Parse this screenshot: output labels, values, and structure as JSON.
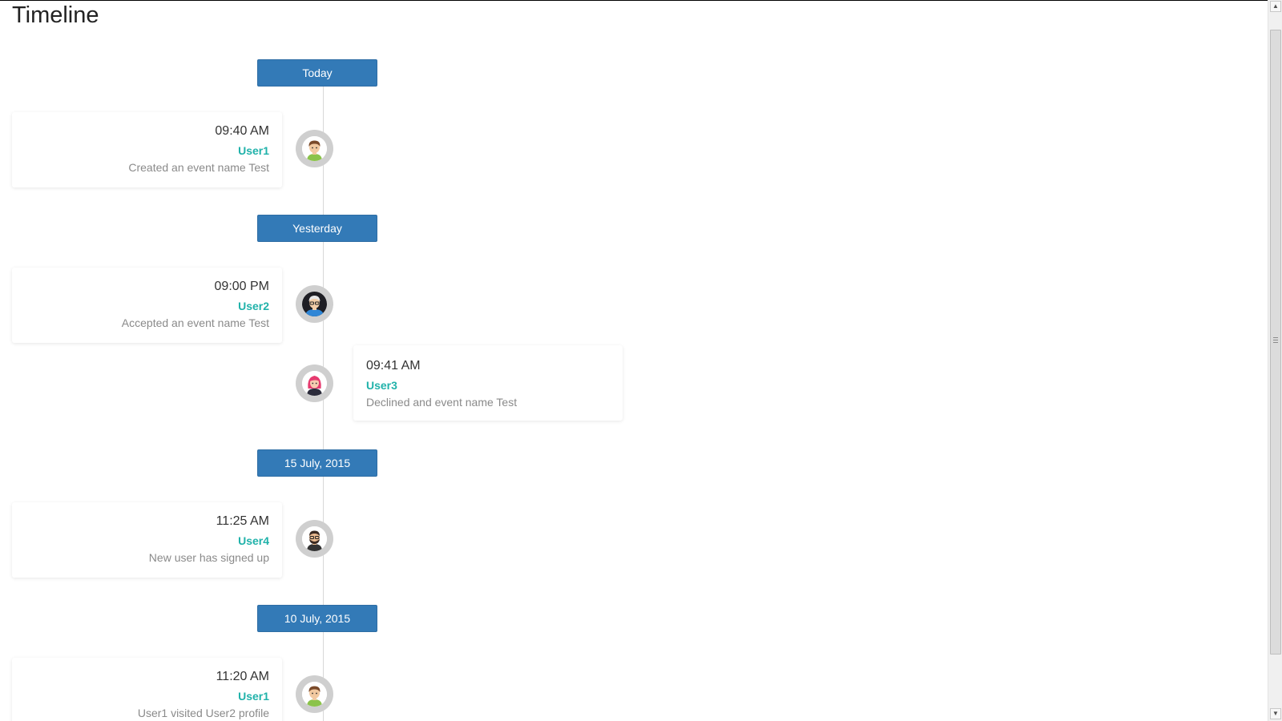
{
  "page": {
    "title": "Timeline"
  },
  "timeline": {
    "dates": [
      {
        "label": "Today"
      },
      {
        "label": "Yesterday"
      },
      {
        "label": "15 July, 2015"
      },
      {
        "label": "10 July, 2015"
      }
    ],
    "events": [
      {
        "side": "left",
        "time": "09:40 AM",
        "user": "User1",
        "action": "Created an event name Test",
        "avatar": "user1-avatar-icon"
      },
      {
        "side": "left",
        "time": "09:00 PM",
        "user": "User2",
        "action": "Accepted an event name Test",
        "avatar": "user2-avatar-icon"
      },
      {
        "side": "right",
        "time": "09:41 AM",
        "user": "User3",
        "action": "Declined and event name Test",
        "avatar": "user3-avatar-icon"
      },
      {
        "side": "left",
        "time": "11:25 AM",
        "user": "User4",
        "action": "New user has signed up",
        "avatar": "user4-avatar-icon"
      },
      {
        "side": "left",
        "time": "11:20 AM",
        "user": "User1",
        "action": "User1 visited User2 profile",
        "avatar": "user1-avatar-icon"
      }
    ]
  },
  "colors": {
    "date_badge": "#337ab7",
    "username": "#20b2aa",
    "action_text": "#8a8a8a",
    "timeline_line": "#d8d8d8",
    "avatar_ring": "#cfcfcf"
  },
  "scrollbar": {
    "up_arrow_icon": "scroll-up-arrow-icon",
    "down_arrow_icon": "scroll-down-arrow-icon"
  }
}
